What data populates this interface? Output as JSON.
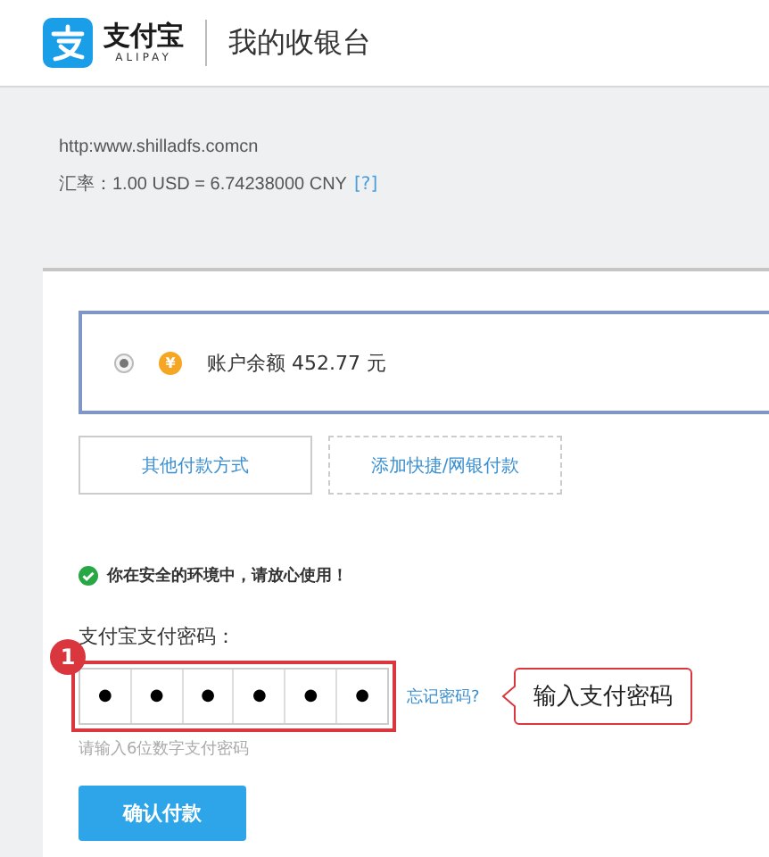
{
  "header": {
    "brand": "支付宝",
    "brand_sub": "ALIPAY",
    "title": "我的收银台"
  },
  "merchant": {
    "url": "http:www.shilladfs.comcn",
    "rate_label": "汇率：1.00 USD = 6.74238000 CNY",
    "rate_help": "[?]"
  },
  "payment_options": [
    {
      "kind": "balance",
      "selected": true,
      "icon_glyph": "¥",
      "label": "账户余额",
      "amount": "452.77 元"
    }
  ],
  "option_buttons": [
    {
      "kind": "solid",
      "label": "其他付款方式"
    },
    {
      "kind": "dashed",
      "label": "添加快捷/网银付款"
    }
  ],
  "security_note": "你在安全的环境中，请放心使用！",
  "password": {
    "label": "支付宝支付密码：",
    "digits": [
      "●",
      "●",
      "●",
      "●",
      "●",
      "●"
    ],
    "forgot": "忘记密码?",
    "hint": "请输入6位数字支付密码",
    "step_badge": "1",
    "callout": "输入支付密码"
  },
  "confirm_button": "确认付款"
}
